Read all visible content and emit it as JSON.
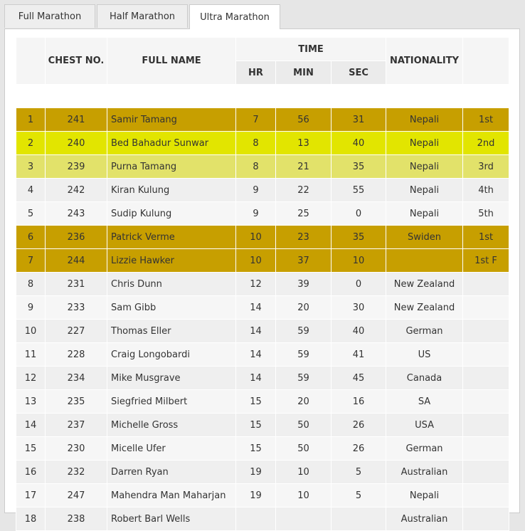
{
  "tabs": [
    {
      "label": "Full Marathon",
      "active": false
    },
    {
      "label": "Half Marathon",
      "active": false
    },
    {
      "label": "Ultra Marathon",
      "active": true
    }
  ],
  "table": {
    "headers": {
      "rank": "",
      "chest_no": "CHEST NO.",
      "full_name": "FULL NAME",
      "time": "TIME",
      "hr": "HR",
      "min": "MIN",
      "sec": "SEC",
      "nationality": "NATIONALITY",
      "position": ""
    },
    "rows": [
      {
        "rank": "1",
        "chest": "241",
        "name": "Samir Tamang",
        "hr": "7",
        "min": "56",
        "sec": "31",
        "nationality": "Nepali",
        "position": "1st",
        "highlight": "gold"
      },
      {
        "rank": "2",
        "chest": "240",
        "name": "Bed Bahadur Sunwar",
        "hr": "8",
        "min": "13",
        "sec": "40",
        "nationality": "Nepali",
        "position": "2nd",
        "highlight": "yellow"
      },
      {
        "rank": "3",
        "chest": "239",
        "name": "Purna Tamang",
        "hr": "8",
        "min": "21",
        "sec": "35",
        "nationality": "Nepali",
        "position": "3rd",
        "highlight": "lightyellow"
      },
      {
        "rank": "4",
        "chest": "242",
        "name": "Kiran Kulung",
        "hr": "9",
        "min": "22",
        "sec": "55",
        "nationality": "Nepali",
        "position": "4th",
        "highlight": "none"
      },
      {
        "rank": "5",
        "chest": "243",
        "name": "Sudip Kulung",
        "hr": "9",
        "min": "25",
        "sec": "0",
        "nationality": "Nepali",
        "position": "5th",
        "highlight": "none"
      },
      {
        "rank": "6",
        "chest": "236",
        "name": "Patrick Verme",
        "hr": "10",
        "min": "23",
        "sec": "35",
        "nationality": "Swiden",
        "position": "1st",
        "highlight": "gold"
      },
      {
        "rank": "7",
        "chest": "244",
        "name": "Lizzie Hawker",
        "hr": "10",
        "min": "37",
        "sec": "10",
        "nationality": "",
        "position": "1st F",
        "highlight": "gold"
      },
      {
        "rank": "8",
        "chest": "231",
        "name": "Chris Dunn",
        "hr": "12",
        "min": "39",
        "sec": "0",
        "nationality": "New Zealand",
        "position": "",
        "highlight": "none"
      },
      {
        "rank": "9",
        "chest": "233",
        "name": "Sam Gibb",
        "hr": "14",
        "min": "20",
        "sec": "30",
        "nationality": "New Zealand",
        "position": "",
        "highlight": "none"
      },
      {
        "rank": "10",
        "chest": "227",
        "name": "Thomas Eller",
        "hr": "14",
        "min": "59",
        "sec": "40",
        "nationality": "German",
        "position": "",
        "highlight": "none"
      },
      {
        "rank": "11",
        "chest": "228",
        "name": "Craig Longobardi",
        "hr": "14",
        "min": "59",
        "sec": "41",
        "nationality": "US",
        "position": "",
        "highlight": "none"
      },
      {
        "rank": "12",
        "chest": "234",
        "name": "Mike Musgrave",
        "hr": "14",
        "min": "59",
        "sec": "45",
        "nationality": "Canada",
        "position": "",
        "highlight": "none"
      },
      {
        "rank": "13",
        "chest": "235",
        "name": "Siegfried Milbert",
        "hr": "15",
        "min": "20",
        "sec": "16",
        "nationality": "SA",
        "position": "",
        "highlight": "none"
      },
      {
        "rank": "14",
        "chest": "237",
        "name": "Michelle Gross",
        "hr": "15",
        "min": "50",
        "sec": "26",
        "nationality": "USA",
        "position": "",
        "highlight": "none"
      },
      {
        "rank": "15",
        "chest": "230",
        "name": "Micelle Ufer",
        "hr": "15",
        "min": "50",
        "sec": "26",
        "nationality": "German",
        "position": "",
        "highlight": "none"
      },
      {
        "rank": "16",
        "chest": "232",
        "name": "Darren Ryan",
        "hr": "19",
        "min": "10",
        "sec": "5",
        "nationality": "Australian",
        "position": "",
        "highlight": "none"
      },
      {
        "rank": "17",
        "chest": "247",
        "name": "Mahendra Man Maharjan",
        "hr": "19",
        "min": "10",
        "sec": "5",
        "nationality": "Nepali",
        "position": "",
        "highlight": "none"
      },
      {
        "rank": "18",
        "chest": "238",
        "name": "Robert Barl Wells",
        "hr": "",
        "min": "",
        "sec": "",
        "nationality": "Australian",
        "position": "",
        "highlight": "none"
      }
    ]
  },
  "colors": {
    "gold": "#c79f00",
    "yellow": "#e2e500",
    "lightyellow": "#e2e26a",
    "row_odd": "#efefef",
    "row_even": "#f6f6f6"
  }
}
